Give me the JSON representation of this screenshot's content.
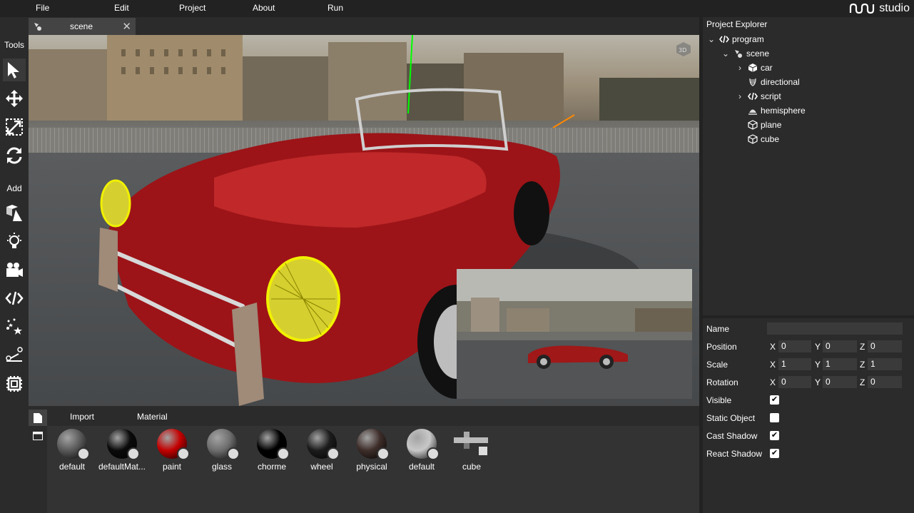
{
  "menu": {
    "file": "File",
    "edit": "Edit",
    "project": "Project",
    "about": "About",
    "run": "Run"
  },
  "logo": {
    "text": "studio"
  },
  "toolbar": {
    "tools_label": "Tools",
    "add_label": "Add"
  },
  "editor_tab": {
    "label": "scene",
    "close": "✕"
  },
  "bottom": {
    "import_label": "Import",
    "material_label": "Material",
    "assets": [
      {
        "label": "default",
        "color": "#5a5a5a"
      },
      {
        "label": "defaultMat...",
        "color": "#0a0a0a"
      },
      {
        "label": "paint",
        "color": "#c40000"
      },
      {
        "label": "glass",
        "color": "#6e6e6e"
      },
      {
        "label": "chorme",
        "color": "#000000"
      },
      {
        "label": "wheel",
        "color": "#1c1c1c"
      },
      {
        "label": "physical",
        "color": "#3e2e2a"
      },
      {
        "label": "default",
        "color": "#c8c8c8"
      },
      {
        "label": "cube",
        "color": "#888888"
      }
    ]
  },
  "explorer": {
    "title": "Project Explorer",
    "nodes": {
      "program": "program",
      "scene": "scene",
      "car": "car",
      "directional": "directional",
      "script": "script",
      "hemisphere": "hemisphere",
      "plane": "plane",
      "cube": "cube"
    }
  },
  "properties": {
    "name_label": "Name",
    "name_value": "",
    "position_label": "Position",
    "position": {
      "x": "0",
      "y": "0",
      "z": "0"
    },
    "scale_label": "Scale",
    "scale": {
      "x": "1",
      "y": "1",
      "z": "1"
    },
    "rotation_label": "Rotation",
    "rotation": {
      "x": "0",
      "y": "0",
      "z": "0"
    },
    "axis_x": "X",
    "axis_y": "Y",
    "axis_z": "Z",
    "visible_label": "Visible",
    "visible": true,
    "static_label": "Static Object",
    "static": false,
    "cast_shadow_label": "Cast Shadow",
    "cast_shadow": true,
    "react_shadow_label": "React Shadow",
    "react_shadow": true
  },
  "colors": {
    "background": "#222222",
    "panel": "#2b2b2b",
    "input": "#3a3a3a",
    "selection_outline": "#f0f000"
  }
}
